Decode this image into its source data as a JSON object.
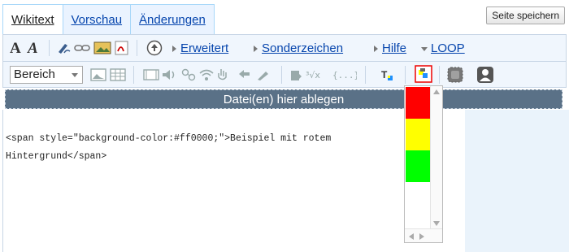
{
  "tabs": [
    {
      "label": "Wikitext",
      "active": true
    },
    {
      "label": "Vorschau",
      "active": false
    },
    {
      "label": "Änderungen",
      "active": false
    }
  ],
  "save_button": "Seite speichern",
  "toolbar": {
    "format_bold": "A",
    "format_italic": "A",
    "menus": {
      "advanced": "Erweitert",
      "special_chars": "Sonderzeichen",
      "help": "Hilfe",
      "loop": "LOOP"
    },
    "section_select": "Bereich"
  },
  "dropzone_text": "Datei(en) hier ablegen",
  "editor": {
    "line1": "<span style=\"background-color:#ff0000;\">Beispiel mit rotem",
    "line2": "Hintergrund</span>"
  },
  "color_swatches": [
    "#ff0000",
    "#ffff00",
    "#00ff00",
    "#ffffff"
  ],
  "colors": {
    "link": "#0645ad",
    "toolbar_bg": "#f0f6fd",
    "dropzone_bg": "#5a7187"
  }
}
